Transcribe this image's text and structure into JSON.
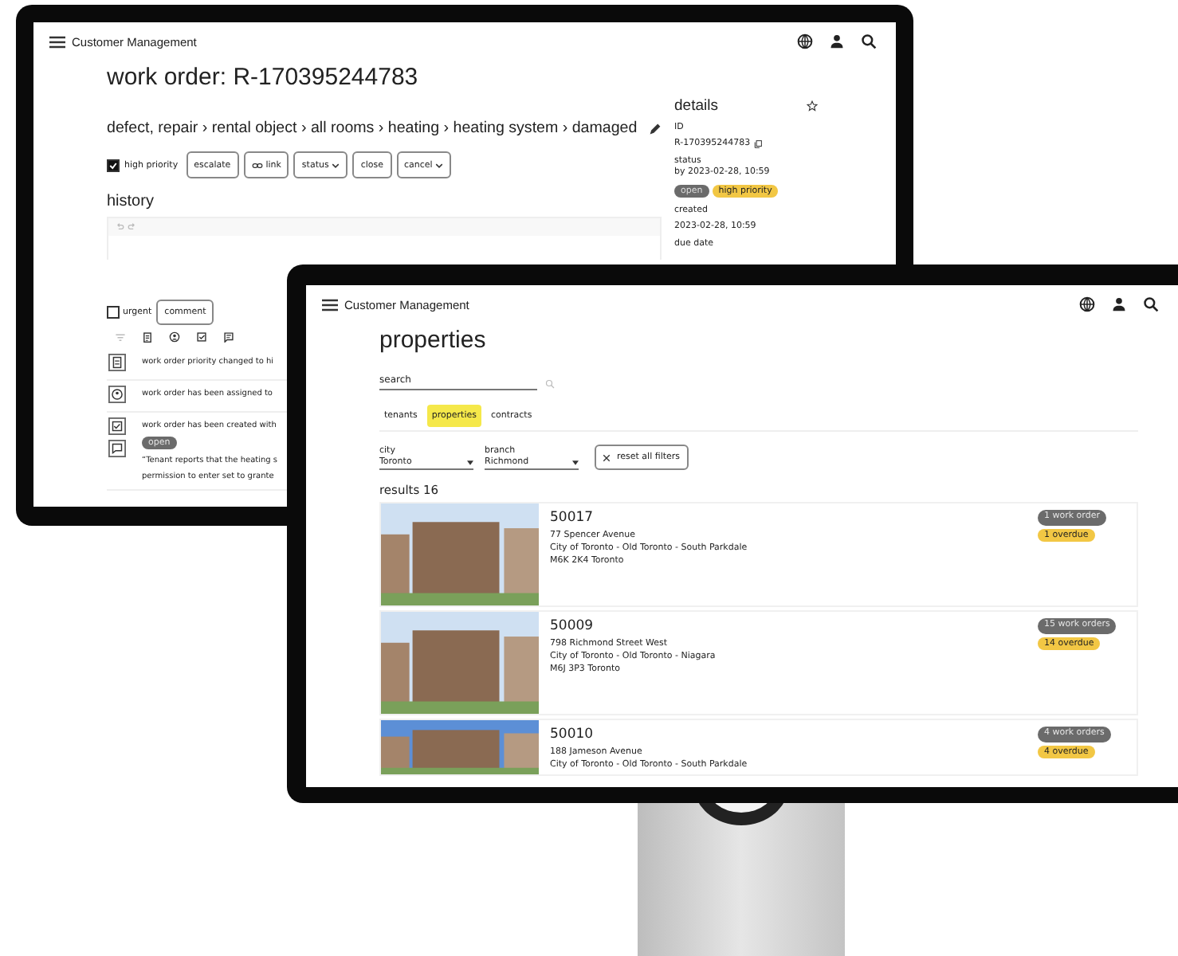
{
  "back_window": {
    "app_title": "Customer Management",
    "title": "work order: R-170395244783",
    "breadcrumb": "defect, repair › rental object › all rooms › heating › heating system › damaged",
    "high_priority": {
      "label": "high priority",
      "checked": true
    },
    "actions": [
      {
        "label": "escalate",
        "kind": "plain"
      },
      {
        "label": "link",
        "kind": "link"
      },
      {
        "label": "status",
        "kind": "menu"
      },
      {
        "label": "close",
        "kind": "plain"
      },
      {
        "label": "cancel",
        "kind": "menu"
      }
    ],
    "history": {
      "heading": "history",
      "urgent": {
        "label": "urgent",
        "checked": false
      },
      "comment_button": "comment",
      "entries": [
        {
          "kind": "priority",
          "text": "work order priority changed to hi"
        },
        {
          "kind": "assigned",
          "text": "work order has been assigned to"
        },
        {
          "kind": "created",
          "text": "work order has been created with",
          "badge": "open",
          "quote": "“Tenant reports that the heating s",
          "note": "permission to enter set to grante"
        }
      ]
    },
    "details": {
      "heading": "details",
      "id_label": "ID",
      "id": "R-170395244783",
      "status_label": "status",
      "status_by": "by 2023-02-28, 10:59",
      "tags": [
        {
          "text": "open",
          "color": "#6b6b6b"
        },
        {
          "text": "high priority",
          "color": "#f2c744"
        }
      ],
      "created_label": "created",
      "created": "2023-02-28, 10:59",
      "due_label": "due date"
    }
  },
  "front_window": {
    "app_title": "Customer Management",
    "title": "properties",
    "search": {
      "placeholder": "search"
    },
    "tabs": [
      {
        "label": "tenants",
        "selected": false
      },
      {
        "label": "properties",
        "selected": true
      },
      {
        "label": "contracts",
        "selected": false
      }
    ],
    "filters": [
      {
        "label": "city",
        "value": "Toronto"
      },
      {
        "label": "branch",
        "value": "Richmond"
      }
    ],
    "reset_button": "reset all filters",
    "results": "results 16",
    "properties": [
      {
        "number": "50017",
        "address": [
          "77 Spencer Avenue",
          "City of Toronto - Old Toronto - South Parkdale",
          "M6K 2K4 Toronto"
        ],
        "work_orders": "1 work order",
        "overdue": "1 overdue"
      },
      {
        "number": "50009",
        "address": [
          "798 Richmond Street West",
          "City of Toronto - Old Toronto - Niagara",
          "M6J 3P3 Toronto"
        ],
        "work_orders": "15 work orders",
        "overdue": "14 overdue"
      },
      {
        "number": "50010",
        "address": [
          "188 Jameson Avenue",
          "City of Toronto - Old Toronto - South Parkdale"
        ],
        "work_orders": "4 work orders",
        "overdue": "4 overdue"
      }
    ]
  }
}
